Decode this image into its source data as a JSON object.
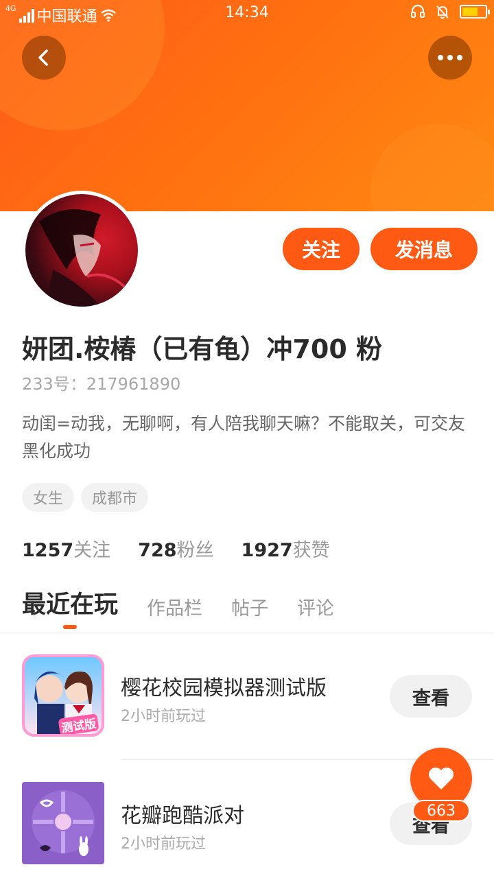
{
  "status_bar": {
    "network": "4G",
    "carrier": "中国联通",
    "time": "14:34"
  },
  "profile": {
    "nickname": "妍团.桉椿（已有龟）冲700 粉",
    "id_label": "233号：217961890",
    "bio": "动闺=动我，无聊啊，有人陪我聊天嘛？不能取关，可交友黑化成功",
    "tags": [
      "女生",
      "成都市"
    ],
    "stats": [
      {
        "num": "1257",
        "label": "关注"
      },
      {
        "num": "728",
        "label": "粉丝"
      },
      {
        "num": "1927",
        "label": "获赞"
      }
    ]
  },
  "actions": {
    "follow_label": "关注",
    "message_label": "发消息"
  },
  "tabs": [
    "最近在玩",
    "作品栏",
    "帖子",
    "评论"
  ],
  "games": [
    {
      "title": "樱花校园模拟器测试版",
      "time": "2小时前玩过",
      "action": "查看",
      "icon": "sakura-school-icon",
      "icon_badge": "测试版"
    },
    {
      "title": "花瓣跑酷派对",
      "time": "2小时前玩过",
      "action": "查看",
      "icon": "petal-parkour-icon"
    }
  ],
  "like": {
    "count": "663"
  },
  "colors": {
    "accent": "#ff5a14",
    "header_gradient_start": "#ff5a1a",
    "header_gradient_end": "#ff8a12"
  }
}
